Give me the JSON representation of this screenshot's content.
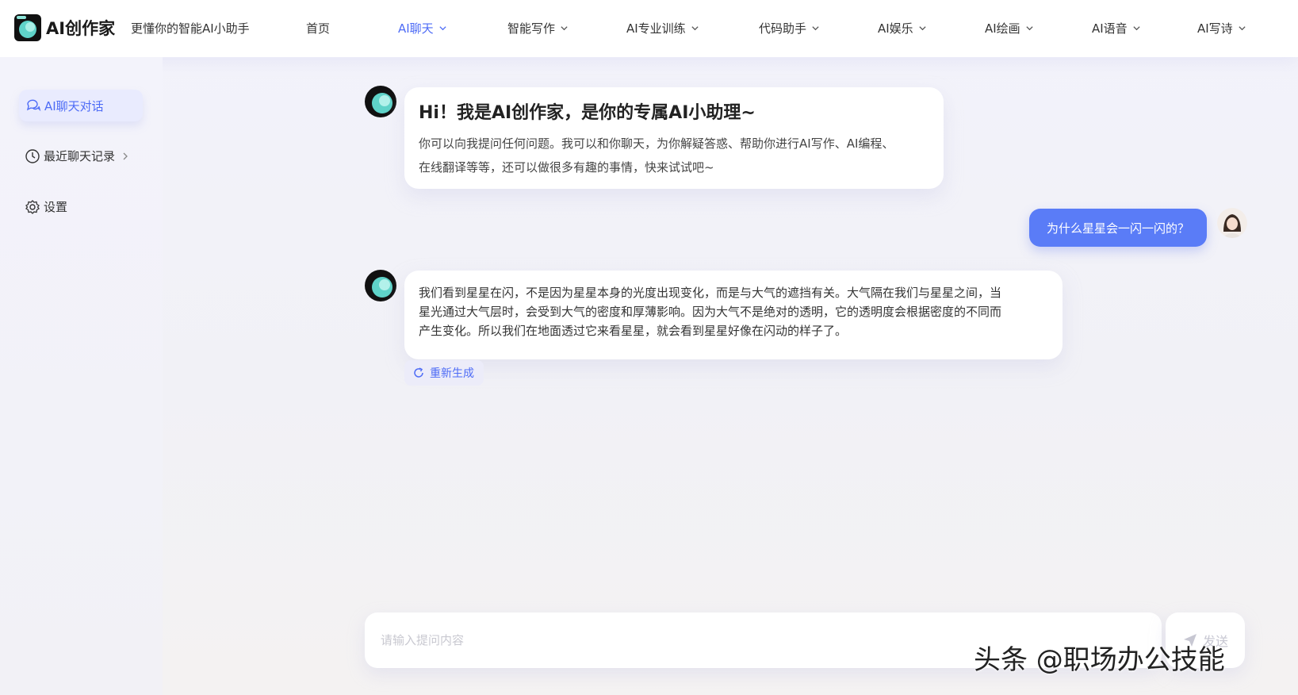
{
  "header": {
    "brand": "AI创作家",
    "slogan": "更懂你的智能AI小助手",
    "nav": [
      {
        "label": "首页",
        "dropdown": false
      },
      {
        "label": "AI聊天",
        "dropdown": true
      },
      {
        "label": "智能写作",
        "dropdown": true
      },
      {
        "label": "AI专业训练",
        "dropdown": true
      },
      {
        "label": "代码助手",
        "dropdown": true
      },
      {
        "label": "AI娱乐",
        "dropdown": true
      },
      {
        "label": "AI绘画",
        "dropdown": true
      },
      {
        "label": "AI语音",
        "dropdown": true
      },
      {
        "label": "AI写诗",
        "dropdown": true
      }
    ],
    "active_nav": "AI聊天"
  },
  "sidebar": {
    "items": [
      {
        "label": "AI聊天对话",
        "icon": "chat-bubbles-icon",
        "active": true
      },
      {
        "label": "最近聊天记录",
        "icon": "clock-icon",
        "active": false,
        "has_arrow": true
      },
      {
        "label": "设置",
        "icon": "gear-icon",
        "active": false
      }
    ]
  },
  "chat": {
    "greeting_title": "Hi！我是AI创作家，是你的专属AI小助理~",
    "greeting_line1": "你可以向我提问任何问题。我可以和你聊天，为你解疑答惑、帮助你进行AI写作、AI编程、",
    "greeting_line2": "在线翻译等等，还可以做很多有趣的事情，快来试试吧~",
    "user_question": "为什么星星会一闪一闪的？",
    "answer_line1": "我们看到星星在闪，不是因为星星本身的光度出现变化，而是与大气的遮挡有关。大气隔在我们与星星之间，当",
    "answer_line2": "星光通过大气层时，会受到大气的密度和厚薄影响。因为大气不是绝对的透明，它的透明度会根据密度的不同而",
    "answer_line3": "产生变化。所以我们在地面透过它来看星星，就会看到星星好像在闪动的样子了。",
    "regenerate_label": "重新生成"
  },
  "input": {
    "placeholder": "请输入提问内容",
    "value": "",
    "send_label": "发送"
  },
  "watermark": "头条 @职场办公技能",
  "colors": {
    "accent": "#4e6cf6",
    "user_bubble": "#5a7cf7",
    "background": "#f2f2f8"
  }
}
